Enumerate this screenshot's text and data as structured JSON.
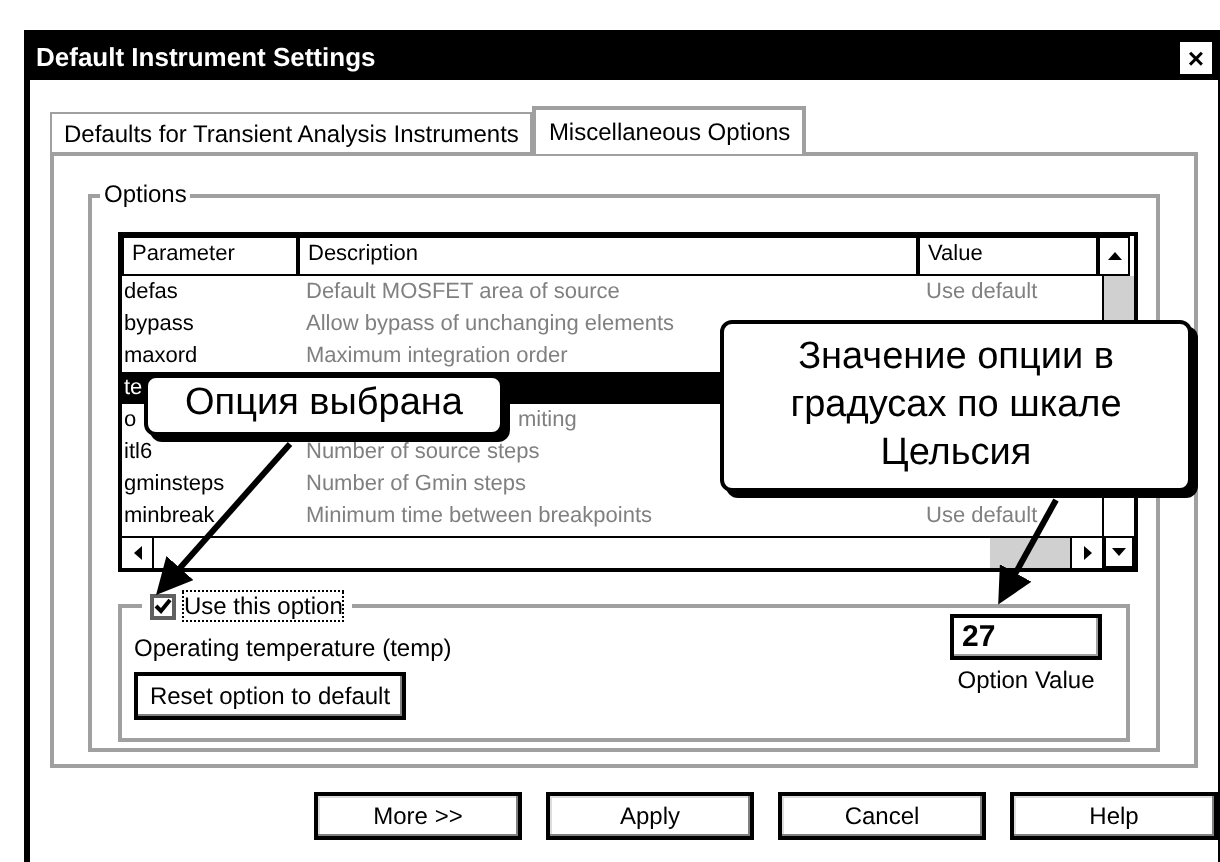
{
  "window": {
    "title": "Default Instrument Settings",
    "close": "×"
  },
  "tabs": [
    {
      "label": "Defaults for Transient Analysis Instruments",
      "selected": false
    },
    {
      "label": "Miscellaneous Options",
      "selected": true
    }
  ],
  "options_group": {
    "title": "Options",
    "table": {
      "columns": [
        "Parameter",
        "Description",
        "Value"
      ],
      "rows": [
        {
          "parameter": "defas",
          "description": "Default MOSFET area of source",
          "value": "Use default",
          "selected": false
        },
        {
          "parameter": "bypass",
          "description": "Allow bypass of unchanging elements",
          "selected": false
        },
        {
          "parameter": "maxord",
          "description": "Maximum integration order",
          "selected": false
        },
        {
          "parameter": "te",
          "selected": true
        },
        {
          "parameter": "o",
          "description": "miting",
          "selected": false
        },
        {
          "parameter": "itl6",
          "description": "Number of source steps",
          "selected": false
        },
        {
          "parameter": "gminsteps",
          "description": "Number of Gmin steps",
          "selected": false
        },
        {
          "parameter": "minbreak",
          "description": "Minimum time between breakpoints",
          "value": "Use default",
          "selected": false
        }
      ]
    },
    "use_option": {
      "label": "Use this option",
      "checked": true
    },
    "option_name": "Operating temperature (temp)",
    "reset_button": "Reset option to default",
    "option_value": {
      "value": "27",
      "label": "Option Value"
    }
  },
  "buttons": [
    "More >>",
    "Apply",
    "Cancel",
    "Help"
  ],
  "callouts": [
    "Опция выбрана",
    "Значение опции в градусах по шкале Цельсия"
  ]
}
